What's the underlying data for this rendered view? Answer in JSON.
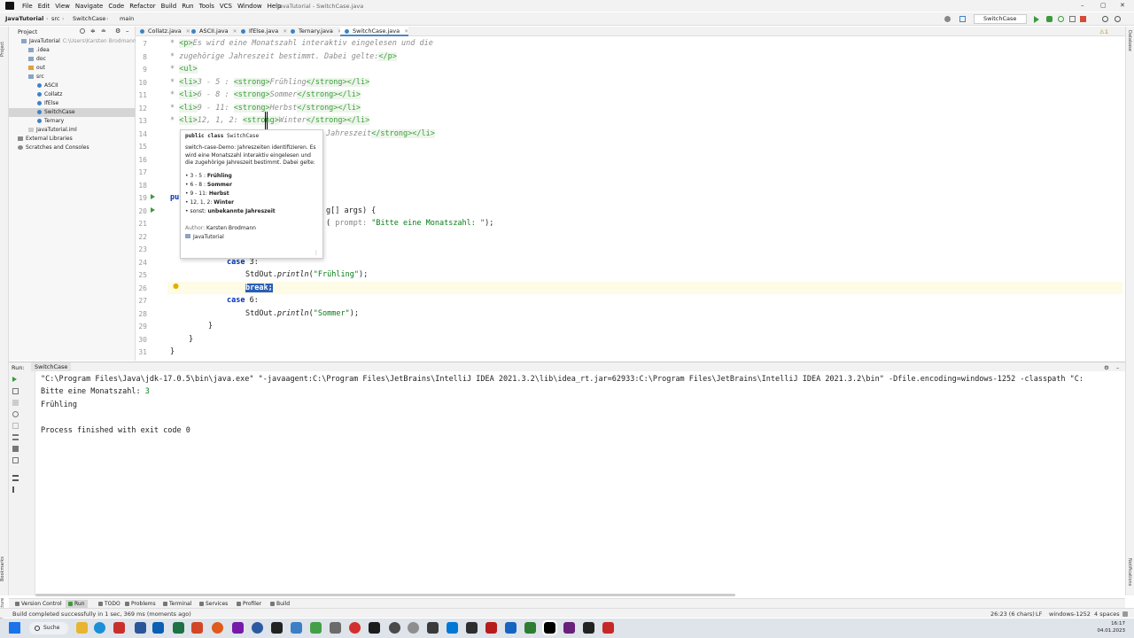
{
  "window_title": "JavaTutorial - SwitchCase.java",
  "menu": [
    "File",
    "Edit",
    "View",
    "Navigate",
    "Code",
    "Refactor",
    "Build",
    "Run",
    "Tools",
    "VCS",
    "Window",
    "Help"
  ],
  "breadcrumb": [
    "JavaTutorial",
    "src",
    "SwitchCase",
    "main"
  ],
  "run_config": "SwitchCase",
  "project_panel": {
    "title": "Project",
    "items": [
      {
        "label": "JavaTutorial",
        "path": "C:\\Users\\Karsten Brodmann",
        "kind": "folder"
      },
      {
        "label": ".idea",
        "kind": "folder"
      },
      {
        "label": "doc",
        "kind": "folder"
      },
      {
        "label": "out",
        "kind": "folder-orange"
      },
      {
        "label": "src",
        "kind": "folder"
      },
      {
        "label": "ASCII",
        "kind": "class"
      },
      {
        "label": "Collatz",
        "kind": "class"
      },
      {
        "label": "IfElse",
        "kind": "class"
      },
      {
        "label": "SwitchCase",
        "kind": "class"
      },
      {
        "label": "Ternary",
        "kind": "class"
      },
      {
        "label": "JavaTutorial.iml",
        "kind": "file"
      },
      {
        "label": "External Libraries",
        "kind": "lib"
      },
      {
        "label": "Scratches and Consoles",
        "kind": "lib"
      }
    ]
  },
  "tabs": [
    {
      "label": "Collatz.java"
    },
    {
      "label": "ASCII.java"
    },
    {
      "label": "IfElse.java"
    },
    {
      "label": "Ternary.java"
    },
    {
      "label": "SwitchCase.java"
    }
  ],
  "line_numbers": [
    "7",
    "8",
    "9",
    "10",
    "11",
    "12",
    "13",
    "14",
    "15",
    "16",
    "17",
    "18",
    "19",
    "20",
    "21",
    "22",
    "23",
    "24",
    "25",
    "26",
    "27",
    "28",
    "29",
    "30",
    "31"
  ],
  "code": {
    "l7_a": "* ",
    "l7_tag1": "<p>",
    "l7_b": "Es wird eine Monatszahl interaktiv eingelesen und die",
    "l8_a": "* zugehörige Jahreszeit bestimmt. Dabei gelte:",
    "l8_tag": "</p>",
    "l9_a": "* ",
    "l9_tag": "<ul>",
    "l10_a": "* ",
    "l10_t1": "<li>",
    "l10_b": "3 - 5 : ",
    "l10_t2": "<strong>",
    "l10_c": "Frühling",
    "l10_t3": "</strong></li>",
    "l11_a": "* ",
    "l11_t1": "<li>",
    "l11_b": "6 - 8 : ",
    "l11_t2": "<strong>",
    "l11_c": "Sommer",
    "l11_t3": "</strong></li>",
    "l12_a": "* ",
    "l12_t1": "<li>",
    "l12_b": "9 - 11: ",
    "l12_t2": "<strong>",
    "l12_c": "Herbst",
    "l12_t3": "</strong></li>",
    "l13_a": "* ",
    "l13_t1": "<li>",
    "l13_b": "12, 1, 2: ",
    "l13_t2": "<strong>",
    "l13_c": "Winter",
    "l13_t3": "</strong></li>",
    "l14_b": "Jahreszeit",
    "l14_t": "</strong></li>",
    "l19": "pu",
    "l20_a": "g[] args) {",
    "l21_hint": "prompt:",
    "l21_str": "\"Bitte eine Monatszahl: \"",
    "l21_a": "( ",
    "l21_b": ");",
    "l24_kw": "case",
    "l24_b": " 3:",
    "l25_a": "StdOut.",
    "l25_m": "println",
    "l25_b": "(",
    "l25_str": "\"Frühling\"",
    "l25_c": ");",
    "l26": "break;",
    "l27_kw": "case",
    "l27_b": " 6:",
    "l28_a": "StdOut.",
    "l28_m": "println",
    "l28_b": "(",
    "l28_str": "\"Sommer\"",
    "l28_c": ");",
    "l29": "}",
    "l30": "}",
    "l31": "}"
  },
  "popup": {
    "signature_kw": "public class",
    "signature_name": "SwitchCase",
    "description": "switch-case-Demo: Jahreszeiten identifizieren. Es wird eine Monatszahl interaktiv eingelesen und die zugehörige Jahreszeit bestimmt. Dabei gelte:",
    "items": [
      {
        "range": "3 - 5 :",
        "season": "Frühling"
      },
      {
        "range": "6 - 8 :",
        "season": "Sommer"
      },
      {
        "range": "9 - 11:",
        "season": "Herbst"
      },
      {
        "range": "12, 1, 2:",
        "season": "Winter"
      },
      {
        "range": "sonst:",
        "season": "unbekannte Jahreszeit"
      }
    ],
    "author_label": "Author:",
    "author": "Karsten Brodmann",
    "module": "JavaTutorial"
  },
  "run_panel": {
    "label": "Run:",
    "tab": "SwitchCase",
    "lines": {
      "cmd": "\"C:\\Program Files\\Java\\jdk-17.0.5\\bin\\java.exe\" \"-javaagent:C:\\Program Files\\JetBrains\\IntelliJ IDEA 2021.3.2\\lib\\idea_rt.jar=62933:C:\\Program Files\\JetBrains\\IntelliJ IDEA 2021.3.2\\bin\" -Dfile.encoding=windows-1252 -classpath \"C:",
      "prompt": "Bitte eine Monatszahl: ",
      "input": "3",
      "output": "Frühling",
      "exit": "Process finished with exit code 0"
    }
  },
  "bottom_tools": [
    "Version Control",
    "Run",
    "TODO",
    "Problems",
    "Terminal",
    "Services",
    "Profiler",
    "Build"
  ],
  "status": {
    "message": "Build completed successfully in 1 sec, 369 ms (moments ago)",
    "position": "26:23 (6 chars)",
    "line_sep": "LF",
    "encoding": "windows-1252",
    "indent": "4 spaces"
  },
  "right_strip": [
    "Database",
    "Notifications"
  ],
  "left_strip": [
    "Project",
    "Structure",
    "Bookmarks"
  ],
  "taskbar": {
    "search": "Suche",
    "time": "16:17",
    "date": "04.01.2023"
  },
  "colors": {
    "accent": "#4a88c7",
    "keyword": "#0033b3",
    "string": "#067d17",
    "selection": "#2a5eb8"
  }
}
